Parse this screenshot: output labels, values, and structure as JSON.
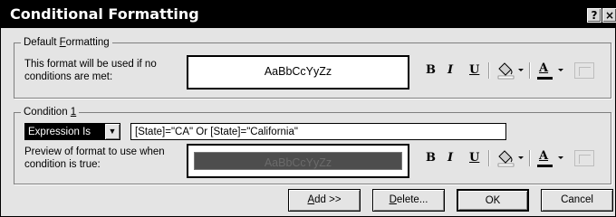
{
  "window": {
    "title": "Conditional Formatting",
    "help_glyph": "?",
    "close_glyph": "×"
  },
  "default_group": {
    "legend_pre": "Default ",
    "legend_key": "F",
    "legend_post": "ormatting",
    "description_line1": "This format will be used if no",
    "description_line2": "conditions are met:",
    "preview_text": "AaBbCcYyZz"
  },
  "condition_group": {
    "legend_pre": "Condition ",
    "legend_key": "1",
    "condition_type": "Expression Is",
    "dropdown_glyph": "▼",
    "expression": "[State]=\"CA\" Or [State]=\"California\"",
    "description_line1": "Preview of format to use when",
    "description_line2": "condition is true:",
    "preview_text": "AaBbCcYyZz"
  },
  "format_toolbar": {
    "bold": "B",
    "italic": "I",
    "underline": "U",
    "font_color_letter": "A",
    "dropdown_glyph": "▼"
  },
  "buttons": {
    "add_key": "A",
    "add_rest": "dd >>",
    "delete_key": "D",
    "delete_rest": "elete...",
    "ok": "OK",
    "cancel": "Cancel"
  },
  "colors": {
    "title_bar": "#000000",
    "dialog_bg": "#e4e4e4",
    "condition_preview_fill": "#4d4d4d"
  }
}
